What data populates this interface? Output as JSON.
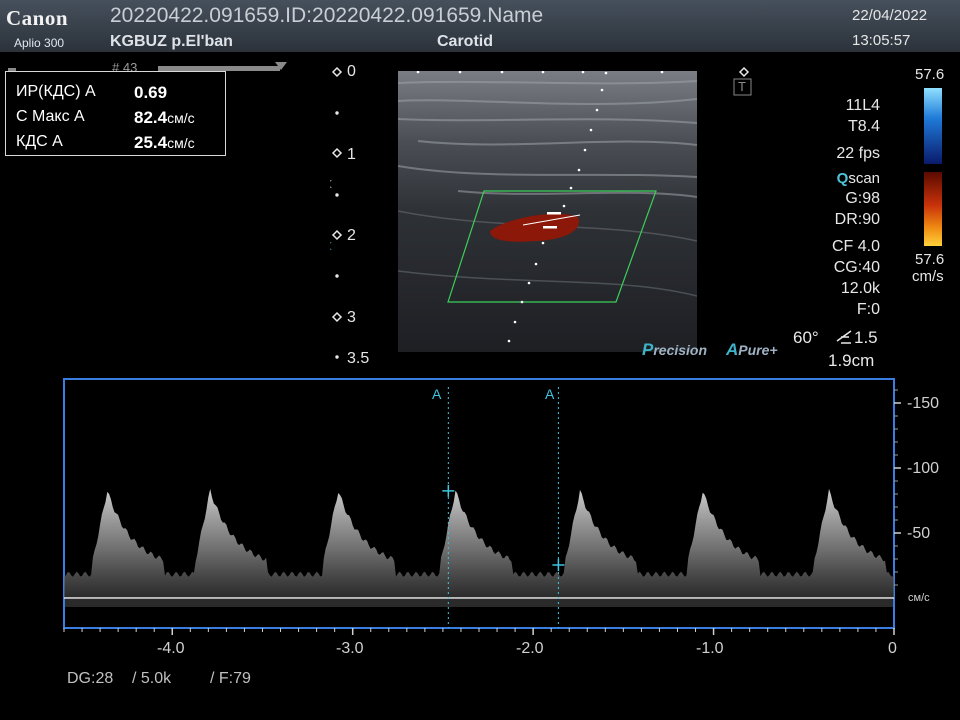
{
  "header": {
    "brand": "Canon",
    "model": "Aplio 300",
    "study_id": "20220422.091659.ID:20220422.091659.Name",
    "institution": "KGBUZ p.El'ban",
    "exam": "Carotid",
    "date": "22/04/2022",
    "time": "13:05:57"
  },
  "frame_label": "# 43",
  "measurements": [
    {
      "label": "ИР(КДС) А",
      "value": "0.69",
      "unit": ""
    },
    {
      "label": "С Макс А",
      "value": "82.4",
      "unit": "см/с"
    },
    {
      "label": "КДС А",
      "value": "25.4",
      "unit": "см/с"
    }
  ],
  "depth_scale": [
    "0",
    "1",
    "2",
    "3",
    "3.5"
  ],
  "params": {
    "probe": "11L4",
    "tis": "T8.4",
    "fps": "22 fps",
    "qscan_q": "Q",
    "qscan_rest": "scan",
    "gain": "G:98",
    "dr": "DR:90",
    "cf": "CF 4.0",
    "cg": "CG:40",
    "prf": "12.0k",
    "filter": "F:0",
    "angle": "60°",
    "angle_corr": "1.5",
    "gate": "1.9cm"
  },
  "colorbar": {
    "top_value": "57.6",
    "bottom_value": "57.6",
    "unit": "cm/s",
    "colors": {
      "pos_top": "#8fe0ff",
      "pos_bottom": "#0a1a6a",
      "neg_top": "#5a0a00",
      "neg_bottom": "#ffd23a"
    }
  },
  "t_marker": "T",
  "precision_label": {
    "p": "P",
    "precision": "recision",
    "a": "A",
    "pure": "Pure+"
  },
  "spectral": {
    "y_ticks": [
      "-150",
      "-100",
      "-50"
    ],
    "y_unit": "см/с",
    "x_ticks": [
      "-4.0",
      "-3.0",
      "-2.0",
      "-1.0",
      "0"
    ],
    "cursor_label": "A"
  },
  "bottom_params": {
    "dg": "DG:28",
    "prf": "/ 5.0k",
    "filter": "/ F:79"
  },
  "chart_data": {
    "type": "area",
    "title": "",
    "xlabel": "",
    "ylabel": "см/с",
    "xlim": [
      -4.6,
      0
    ],
    "ylim": [
      0,
      165
    ],
    "x_ticks": [
      -4.0,
      -3.0,
      -2.0,
      -1.0,
      0
    ],
    "y_ticks": [
      50,
      100,
      150
    ],
    "peaks_x": [
      -4.4,
      -3.83,
      -3.12,
      -2.47,
      -1.78,
      -1.1,
      -0.4
    ],
    "peak_systolic": 82.4,
    "end_diastolic": 25.4,
    "cursors_x": [
      -2.47,
      -1.86
    ]
  }
}
